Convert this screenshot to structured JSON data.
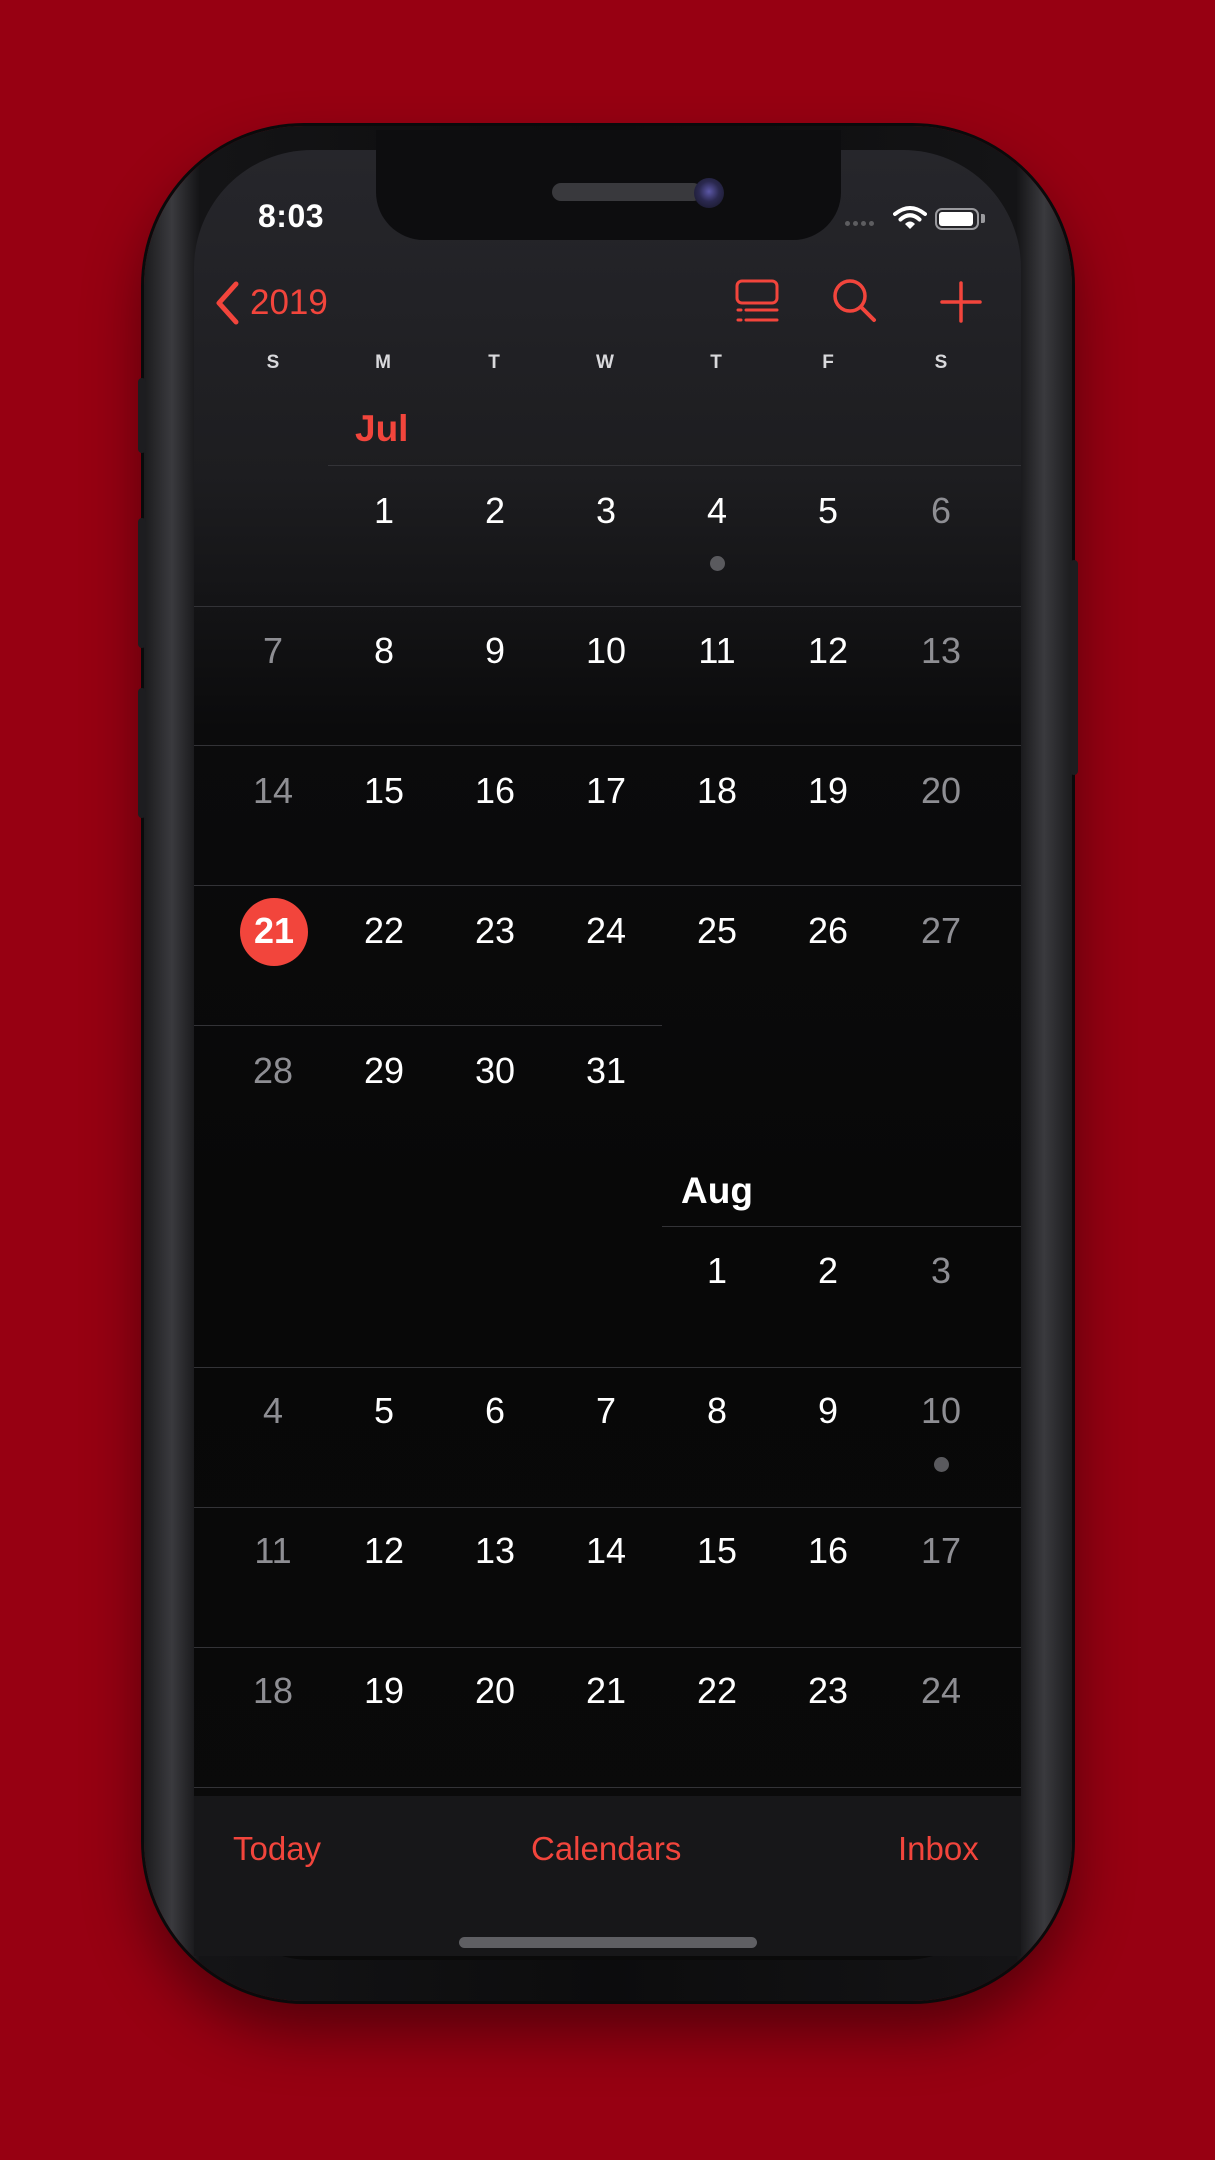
{
  "status_bar": {
    "time": "8:03"
  },
  "nav": {
    "back_label": "2019",
    "icons": [
      "list-view-icon",
      "search-icon",
      "add-icon"
    ]
  },
  "weekdays": [
    "S",
    "M",
    "T",
    "W",
    "T",
    "F",
    "S"
  ],
  "months": [
    {
      "label": "Jul",
      "color": "#f2453c",
      "weeks": [
        [
          "",
          "1",
          "2",
          "3",
          "4",
          "5",
          "6"
        ],
        [
          "7",
          "8",
          "9",
          "10",
          "11",
          "12",
          "13"
        ],
        [
          "14",
          "15",
          "16",
          "17",
          "18",
          "19",
          "20"
        ],
        [
          "21",
          "22",
          "23",
          "24",
          "25",
          "26",
          "27"
        ],
        [
          "28",
          "29",
          "30",
          "31",
          "",
          "",
          ""
        ]
      ]
    },
    {
      "label": "Aug",
      "color": "#ffffff",
      "weeks": [
        [
          "",
          "",
          "",
          "",
          "1",
          "2",
          "3"
        ],
        [
          "4",
          "5",
          "6",
          "7",
          "8",
          "9",
          "10"
        ],
        [
          "11",
          "12",
          "13",
          "14",
          "15",
          "16",
          "17"
        ],
        [
          "18",
          "19",
          "20",
          "21",
          "22",
          "23",
          "24"
        ]
      ]
    }
  ],
  "today": "21",
  "event_days": [
    {
      "month": "Jul",
      "day": "4"
    },
    {
      "month": "Aug",
      "day": "10"
    }
  ],
  "tab_bar": {
    "today": "Today",
    "calendars": "Calendars",
    "inbox": "Inbox"
  },
  "colors": {
    "accent": "#f2453c",
    "background": "#970012",
    "weekend_text": "#8e8e93",
    "event_dot": "#5a5a5e"
  }
}
